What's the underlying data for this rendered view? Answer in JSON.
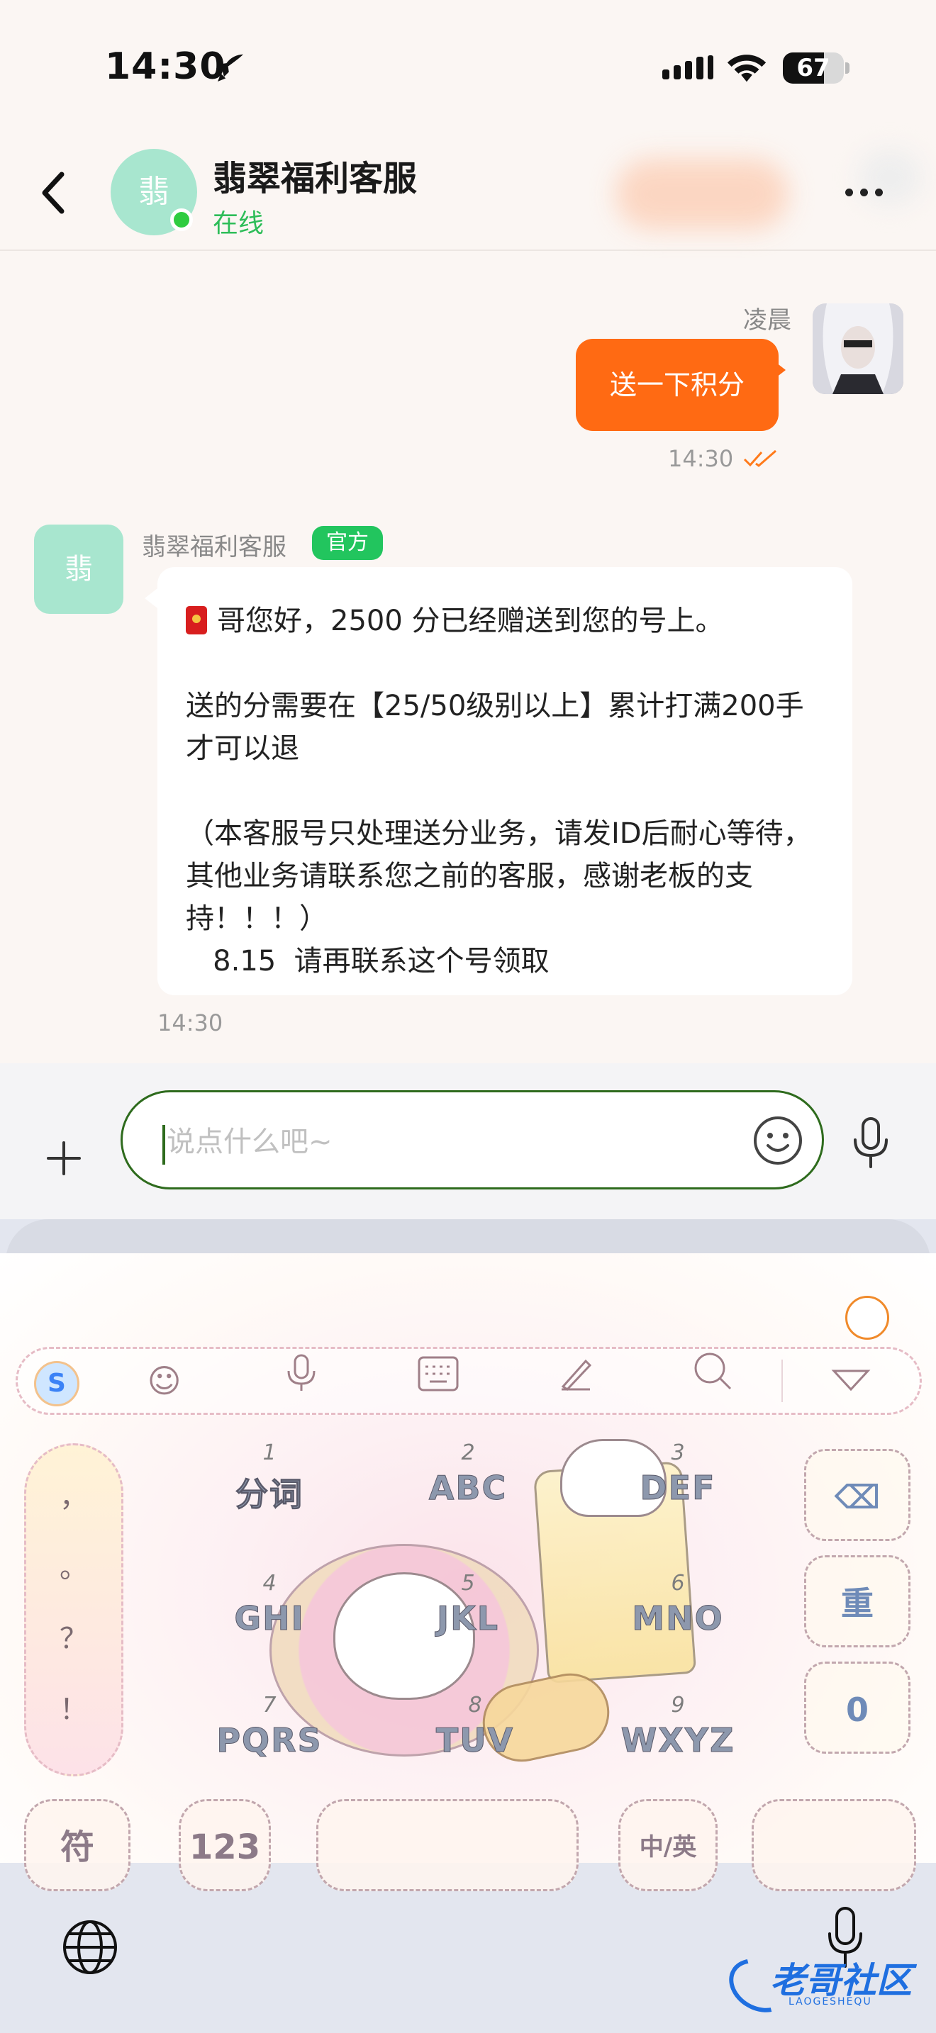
{
  "status_bar": {
    "time": "14:30",
    "battery_percent": "67",
    "battery_level": 0.67
  },
  "header": {
    "contact_name": "翡翠福利客服",
    "contact_status": "在线",
    "avatar_text": "翡"
  },
  "messages": [
    {
      "direction": "outgoing",
      "sender": "凌晨",
      "text": "送一下积分",
      "time": "14:30",
      "read": true
    },
    {
      "direction": "incoming",
      "sender": "翡翠福利客服",
      "badge": "官方",
      "avatar_text": "翡",
      "text": "哥您好，2500 分已经赠送到您的号上。\n\n送的分需要在【25/50级别以上】累计打满200手才可以退\n\n（本客服号只处理送分业务，请发ID后耐心等待，其他业务请联系您之前的客服，感谢老板的支持！！！）\n   8.15  请再联系这个号领取",
      "time": "14:30"
    }
  ],
  "input": {
    "placeholder": "说点什么吧~"
  },
  "keyboard": {
    "punctuation": [
      "，",
      "。",
      "？",
      "！"
    ],
    "keys": [
      {
        "num": "1",
        "letters": "分词"
      },
      {
        "num": "2",
        "letters": "ABC"
      },
      {
        "num": "3",
        "letters": "DEF"
      },
      {
        "num": "4",
        "letters": "GHI"
      },
      {
        "num": "5",
        "letters": "JKL"
      },
      {
        "num": "6",
        "letters": "MNO"
      },
      {
        "num": "7",
        "letters": "PQRS"
      },
      {
        "num": "8",
        "letters": "TUV"
      },
      {
        "num": "9",
        "letters": "WXYZ"
      }
    ],
    "side_keys": [
      "⌫",
      "重",
      "0"
    ],
    "bottom_keys": {
      "symbols": "符",
      "numbers": "123",
      "language": "中/英"
    },
    "toolbar_logo": "S"
  },
  "watermark": {
    "title": "老哥社区",
    "subtitle": "LAOGESHEQU"
  }
}
